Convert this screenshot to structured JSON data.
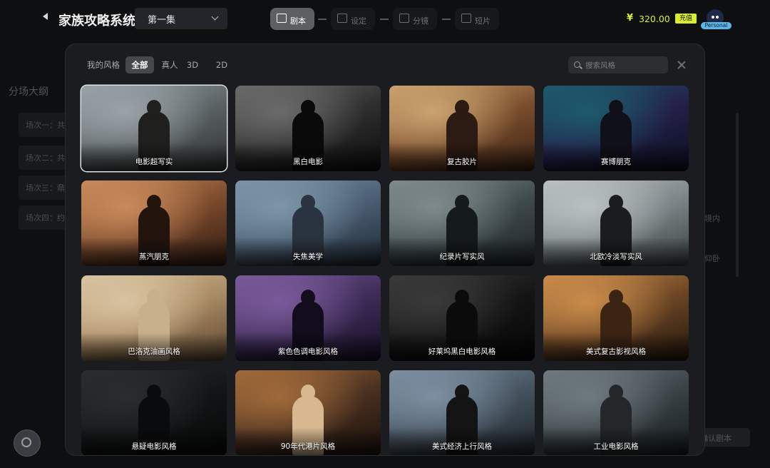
{
  "header": {
    "title": "家族攻略系统",
    "episode": "第一集",
    "steps": [
      "剧本",
      "设定",
      "分镜",
      "短片"
    ],
    "active_step": 0,
    "currency_symbol": "¥",
    "balance": "320.00",
    "recharge_label": "充值",
    "plan_badge": "Personal"
  },
  "background": {
    "outline_title": "分场大纲",
    "scenes": [
      "场次一：共",
      "场次二：共",
      "场次三：鼎",
      "场次四：约"
    ],
    "right_text_1": "境内",
    "right_text_2": "仰卧",
    "confirm_label": "确认剧本"
  },
  "modal": {
    "tabs": [
      "我的风格",
      "全部",
      "真人",
      "3D",
      "2D"
    ],
    "active_tab": 1,
    "search_placeholder": "搜索风格",
    "styles": [
      {
        "label": "电影超写实",
        "selected": true,
        "palette": [
          "#9aa3a8",
          "#5b6264",
          "#2e3131"
        ],
        "figure": "#1f1f1d"
      },
      {
        "label": "黑白电影",
        "selected": false,
        "palette": [
          "#6a6a6a",
          "#2e2e2e",
          "#0d0d0d"
        ],
        "figure": "#0a0a0a"
      },
      {
        "label": "复古胶片",
        "selected": false,
        "palette": [
          "#c9a26f",
          "#7a4e2d",
          "#3a2114"
        ],
        "figure": "#2b1b12"
      },
      {
        "label": "赛博朋克",
        "selected": false,
        "palette": [
          "#1d5a6b",
          "#24204a",
          "#0a0f1e"
        ],
        "figure": "#101018"
      },
      {
        "label": "蒸汽朋克",
        "selected": false,
        "palette": [
          "#c98a5a",
          "#7a4a2c",
          "#2e1a12"
        ],
        "figure": "#23150e"
      },
      {
        "label": "失焦美学",
        "selected": false,
        "palette": [
          "#7d95a8",
          "#4b5e72",
          "#1e2834"
        ],
        "figure": "#2a3440"
      },
      {
        "label": "纪录片写实风",
        "selected": false,
        "palette": [
          "#7e8a8c",
          "#3f4a4c",
          "#1c2324"
        ],
        "figure": "#151a1b"
      },
      {
        "label": "北欧冷淡写实风",
        "selected": false,
        "palette": [
          "#b9c0c2",
          "#7b8486",
          "#3a4042"
        ],
        "figure": "#1a1c1e"
      },
      {
        "label": "巴洛克油画风格",
        "selected": false,
        "palette": [
          "#d9c3a0",
          "#a88a63",
          "#5a4530"
        ],
        "figure": "#c9b08c"
      },
      {
        "label": "紫色色调电影风格",
        "selected": false,
        "palette": [
          "#7a5a9a",
          "#3e2c58",
          "#160f24"
        ],
        "figure": "#120c1c"
      },
      {
        "label": "好莱坞黑白电影风格",
        "selected": false,
        "palette": [
          "#3a3a3a",
          "#151515",
          "#050505"
        ],
        "figure": "#0b0b0b"
      },
      {
        "label": "美式复古影视风格",
        "selected": false,
        "palette": [
          "#c98b4a",
          "#6a4524",
          "#24160c"
        ],
        "figure": "#3b2414"
      },
      {
        "label": "悬疑电影风格",
        "selected": false,
        "palette": [
          "#2a2d2f",
          "#131516",
          "#060707"
        ],
        "figure": "#0a0b0c"
      },
      {
        "label": "90年代港片风格",
        "selected": false,
        "palette": [
          "#a06a3a",
          "#4a3020",
          "#1a100a"
        ],
        "figure": "#d8b890"
      },
      {
        "label": "美式经济上行风格",
        "selected": false,
        "palette": [
          "#7c8fa0",
          "#45525e",
          "#1c2228"
        ],
        "figure": "#141414"
      },
      {
        "label": "工业电影风格",
        "selected": false,
        "palette": [
          "#6f7a80",
          "#3a4246",
          "#151a1c"
        ],
        "figure": "#23272a"
      }
    ]
  }
}
